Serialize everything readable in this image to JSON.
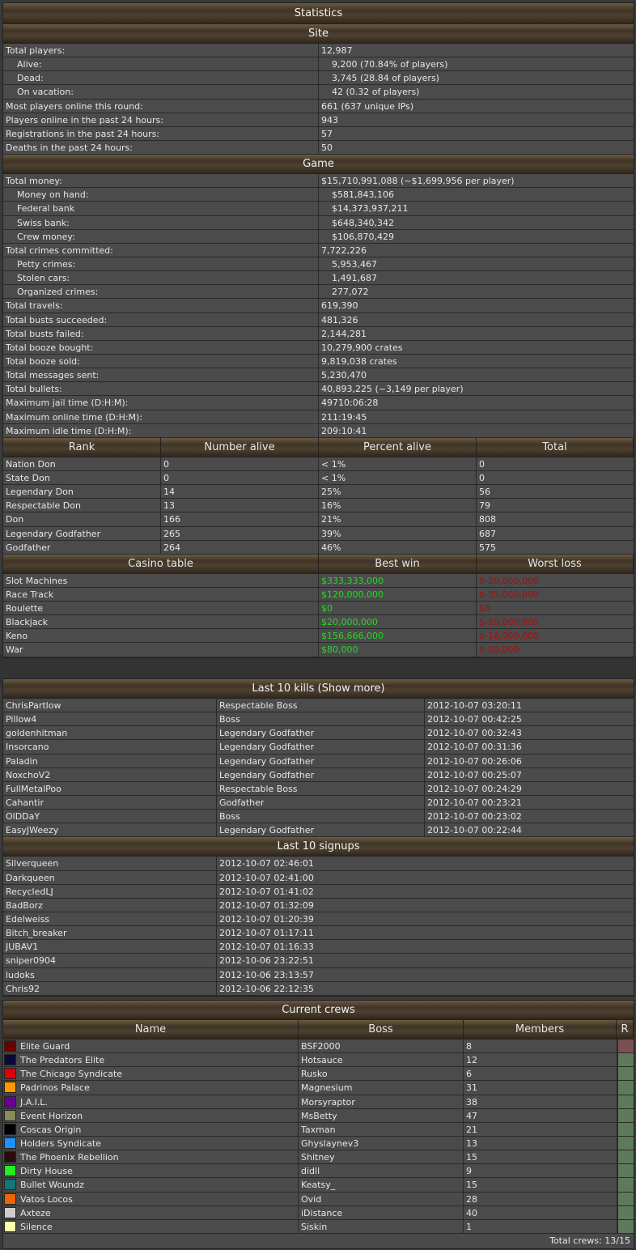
{
  "stats": {
    "title": "Statistics",
    "site_title": "Site",
    "site_rows": [
      {
        "label": "Total players:",
        "value": "12,987",
        "indent": false
      },
      {
        "label": "Alive:",
        "value": "9,200 (70.84% of players)",
        "indent": true
      },
      {
        "label": "Dead:",
        "value": "3,745 (28.84 of players)",
        "indent": true
      },
      {
        "label": "On vacation:",
        "value": "42 (0.32 of players)",
        "indent": true
      },
      {
        "label": "Most players online this round:",
        "value": "661 (637 unique IPs)",
        "indent": false
      },
      {
        "label": "Players online in the past 24 hours:",
        "value": "943",
        "indent": false
      },
      {
        "label": "Registrations in the past 24 hours:",
        "value": "57",
        "indent": false
      },
      {
        "label": "Deaths in the past 24 hours:",
        "value": "50",
        "indent": false
      }
    ],
    "game_title": "Game",
    "game_rows": [
      {
        "label": "Total money:",
        "value": "$15,710,991,088 (~$1,699,956 per player)",
        "indent": false
      },
      {
        "label": "Money on hand:",
        "value": "$581,843,106",
        "indent": true
      },
      {
        "label": "Federal bank",
        "value": "$14,373,937,211",
        "indent": true
      },
      {
        "label": "Swiss bank:",
        "value": "$648,340,342",
        "indent": true
      },
      {
        "label": "Crew money:",
        "value": "$106,870,429",
        "indent": true
      },
      {
        "label": "Total crimes committed:",
        "value": "7,722,226",
        "indent": false
      },
      {
        "label": "Petty crimes:",
        "value": "5,953,467",
        "indent": true
      },
      {
        "label": "Stolen cars:",
        "value": "1,491,687",
        "indent": true
      },
      {
        "label": "Organized crimes:",
        "value": "277,072",
        "indent": true
      },
      {
        "label": "Total travels:",
        "value": "619,390",
        "indent": false
      },
      {
        "label": "Total busts succeeded:",
        "value": "481,326",
        "indent": false
      },
      {
        "label": "Total busts failed:",
        "value": "2,144,281",
        "indent": false
      },
      {
        "label": "Total booze bought:",
        "value": "10,279,900 crates",
        "indent": false
      },
      {
        "label": "Total booze sold:",
        "value": "9,819,038 crates",
        "indent": false
      },
      {
        "label": "Total messages sent:",
        "value": "5,230,470",
        "indent": false
      },
      {
        "label": "Total bullets:",
        "value": "40,893,225 (~3,149 per player)",
        "indent": false
      },
      {
        "label": "Maximum jail time (D:H:M):",
        "value": "49710:06:28",
        "indent": false
      },
      {
        "label": "Maximum online time (D:H:M):",
        "value": "211:19:45",
        "indent": false
      },
      {
        "label": "Maximum idle time (D:H:M):",
        "value": "209:10:41",
        "indent": false
      }
    ],
    "rank_headers": [
      "Rank",
      "Number alive",
      "Percent alive",
      "Total"
    ],
    "rank_rows": [
      [
        "Nation Don",
        "0",
        "< 1%",
        "0"
      ],
      [
        "State Don",
        "0",
        "< 1%",
        "0"
      ],
      [
        "Legendary Don",
        "14",
        "25%",
        "56"
      ],
      [
        "Respectable Don",
        "13",
        "16%",
        "79"
      ],
      [
        "Don",
        "166",
        "21%",
        "808"
      ],
      [
        "Legendary Godfather",
        "265",
        "39%",
        "687"
      ],
      [
        "Godfather",
        "264",
        "46%",
        "575"
      ]
    ],
    "casino_headers": [
      "Casino table",
      "Best win",
      "Worst loss"
    ],
    "casino_rows": [
      [
        "Slot Machines",
        "$333,333,000",
        "$-20,000,000"
      ],
      [
        "Race Track",
        "$120,000,000",
        "$-35,000,000"
      ],
      [
        "Roulette",
        "$0",
        "$0"
      ],
      [
        "Blackjack",
        "$20,000,000",
        "$-20,000,000"
      ],
      [
        "Keno",
        "$156,666,000",
        "$-18,900,000"
      ],
      [
        "War",
        "$80,000",
        "$-20,000"
      ]
    ]
  },
  "kills": {
    "title": "Last 10 kills (Show more)",
    "rows": [
      [
        "ChrisPartlow",
        "Respectable Boss",
        "2012-10-07 03:20:11"
      ],
      [
        "Pillow4",
        "Boss",
        "2012-10-07 00:42:25"
      ],
      [
        "goldenhitman",
        "Legendary Godfather",
        "2012-10-07 00:32:43"
      ],
      [
        "Insorcano",
        "Legendary Godfather",
        "2012-10-07 00:31:36"
      ],
      [
        "Paladin",
        "Legendary Godfather",
        "2012-10-07 00:26:06"
      ],
      [
        "NoxchoV2",
        "Legendary Godfather",
        "2012-10-07 00:25:07"
      ],
      [
        "FullMetalPoo",
        "Respectable Boss",
        "2012-10-07 00:24:29"
      ],
      [
        "Cahantir",
        "Godfather",
        "2012-10-07 00:23:21"
      ],
      [
        "OlDDaY",
        "Boss",
        "2012-10-07 00:23:02"
      ],
      [
        "EasyJWeezy",
        "Legendary Godfather",
        "2012-10-07 00:22:44"
      ]
    ]
  },
  "signups": {
    "title": "Last 10 signups",
    "rows": [
      [
        "Silverqueen",
        "2012-10-07 02:46:01"
      ],
      [
        "Darkqueen",
        "2012-10-07 02:41:00"
      ],
      [
        "RecycledLJ",
        "2012-10-07 01:41:02"
      ],
      [
        "BadBorz",
        "2012-10-07 01:32:09"
      ],
      [
        "Edelweiss",
        "2012-10-07 01:20:39"
      ],
      [
        "Bitch_breaker",
        "2012-10-07 01:17:11"
      ],
      [
        "JUBAV1",
        "2012-10-07 01:16:33"
      ],
      [
        "sniper0904",
        "2012-10-06 23:22:51"
      ],
      [
        "ludoks",
        "2012-10-06 23:13:57"
      ],
      [
        "Chris92",
        "2012-10-06 22:12:35"
      ]
    ]
  },
  "crews": {
    "title": "Current crews",
    "headers": [
      "Name",
      "Boss",
      "Members",
      "R"
    ],
    "rows": [
      {
        "color": "#6b0000",
        "name": "Elite Guard",
        "boss": "BSF2000",
        "members": "8",
        "r": "#7a5050"
      },
      {
        "color": "#0a0a3a",
        "name": "The Predators Elite",
        "boss": "Hotsauce",
        "members": "12",
        "r": "#5d7a5d"
      },
      {
        "color": "#dd0000",
        "name": "The Chicago Syndicate",
        "boss": "Rusko",
        "members": "6",
        "r": "#5d7a5d"
      },
      {
        "color": "#ff9900",
        "name": "Padrinos Palace",
        "boss": "Magnesium",
        "members": "31",
        "r": "#5d7a5d"
      },
      {
        "color": "#660099",
        "name": "J.A.I.L.",
        "boss": "Morsyraptor",
        "members": "38",
        "r": "#5d7a5d"
      },
      {
        "color": "#8a8a5a",
        "name": "Event Horizon",
        "boss": "MsBetty",
        "members": "47",
        "r": "#5d7a5d"
      },
      {
        "color": "#000000",
        "name": "Coscas Origin",
        "boss": "Taxman",
        "members": "21",
        "r": "#5d7a5d"
      },
      {
        "color": "#1e90ff",
        "name": "Holders Syndicate",
        "boss": "Ghyslaynev3",
        "members": "13",
        "r": "#5d7a5d"
      },
      {
        "color": "#2a0a0a",
        "name": "The Phoenix Rebellion",
        "boss": "Shitney",
        "members": "15",
        "r": "#5d7a5d"
      },
      {
        "color": "#22ee22",
        "name": "Dirty House",
        "boss": "didll",
        "members": "9",
        "r": "#5d7a5d"
      },
      {
        "color": "#117777",
        "name": "Bullet Woundz",
        "boss": "Keatsy_",
        "members": "15",
        "r": "#5d7a5d"
      },
      {
        "color": "#ee6600",
        "name": "Vatos Locos",
        "boss": "Ovid",
        "members": "28",
        "r": "#5d7a5d"
      },
      {
        "color": "#cccccc",
        "name": "Axteze",
        "boss": "iDistance",
        "members": "40",
        "r": "#5d7a5d"
      },
      {
        "color": "#ffffaa",
        "name": "Silence",
        "boss": "Siskin",
        "members": "1",
        "r": "#5d7a5d"
      }
    ],
    "footer": "Total crews: 13/15"
  }
}
